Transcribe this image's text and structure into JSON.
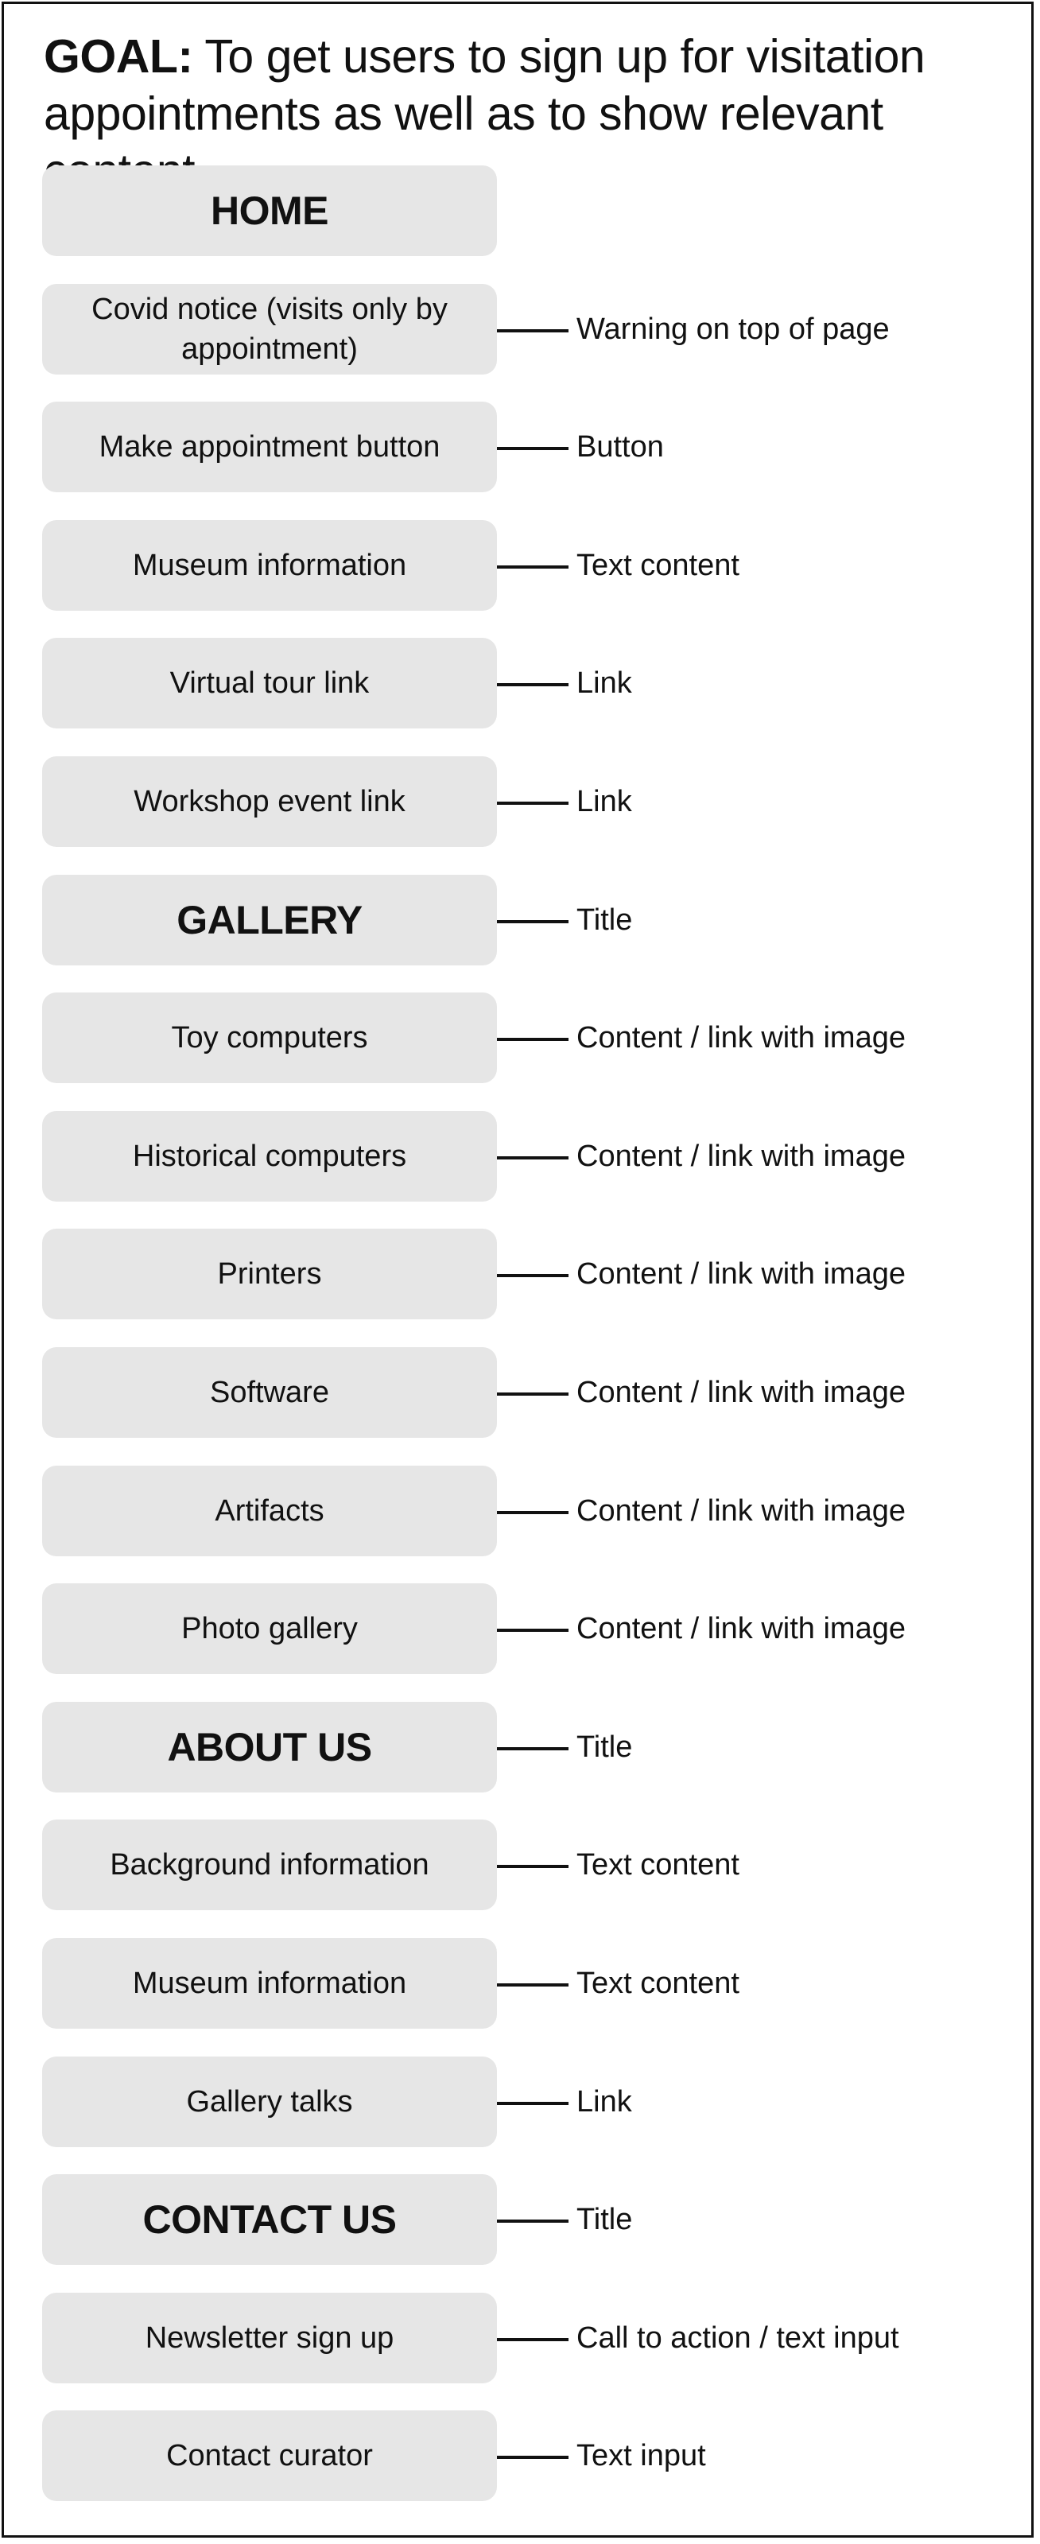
{
  "goal": {
    "label": "GOAL:",
    "text": " To get users to sign up for visitation appointments as well as to show relevant content"
  },
  "rows": [
    {
      "item": "HOME",
      "note": "",
      "title": true
    },
    {
      "item": "Covid notice (visits only by appointment)",
      "note": "Warning on top of page",
      "title": false
    },
    {
      "item": "Make appointment button",
      "note": "Button",
      "title": false
    },
    {
      "item": "Museum information",
      "note": "Text content",
      "title": false
    },
    {
      "item": "Virtual tour link",
      "note": "Link",
      "title": false
    },
    {
      "item": "Workshop event link",
      "note": "Link",
      "title": false
    },
    {
      "item": "GALLERY",
      "note": "Title",
      "title": true
    },
    {
      "item": "Toy computers",
      "note": "Content / link with image",
      "title": false
    },
    {
      "item": "Historical computers",
      "note": "Content / link with image",
      "title": false
    },
    {
      "item": "Printers",
      "note": "Content / link with image",
      "title": false
    },
    {
      "item": "Software",
      "note": "Content / link with image",
      "title": false
    },
    {
      "item": "Artifacts",
      "note": "Content / link with image",
      "title": false
    },
    {
      "item": "Photo gallery",
      "note": "Content / link with image",
      "title": false
    },
    {
      "item": "ABOUT US",
      "note": "Title",
      "title": true
    },
    {
      "item": "Background information",
      "note": "Text content",
      "title": false
    },
    {
      "item": "Museum information",
      "note": "Text content",
      "title": false
    },
    {
      "item": "Gallery talks",
      "note": "Link",
      "title": false
    },
    {
      "item": "CONTACT US",
      "note": "Title",
      "title": true
    },
    {
      "item": "Newsletter sign up",
      "note": "Call to action / text input",
      "title": false
    },
    {
      "item": "Contact curator",
      "note": "Text input",
      "title": false
    }
  ]
}
